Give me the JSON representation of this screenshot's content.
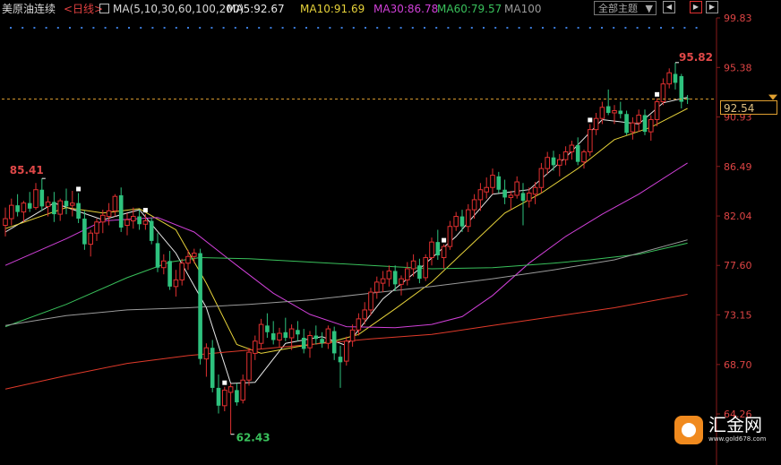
{
  "header": {
    "title": "美原油连续",
    "period": "<日线>",
    "ma_label": "MA(5,10,30,60,100,200)",
    "ma5": "MA5:92.67",
    "ma10": "MA10:91.69",
    "ma30": "MA30:86.78",
    "ma60": "MA60:79.57",
    "ma100": "MA100",
    "theme_dropdown": "全部主题",
    "theme_arrow": "▼"
  },
  "colors": {
    "up": "#e03030",
    "down": "#2ec27e",
    "ma5": "#e8e8e8",
    "ma10": "#e6d23a",
    "ma30": "#d040d8",
    "ma60": "#39c05b",
    "ma100": "#9a9a9a",
    "ma200": "#e03a2a",
    "current_line": "#e0a030"
  },
  "chart_data": {
    "type": "candlestick",
    "y_ticks": [
      "99.83",
      "95.38",
      "90.93",
      "86.49",
      "82.04",
      "77.60",
      "73.15",
      "68.70",
      "64.26"
    ],
    "ylim": [
      64.26,
      99.83
    ],
    "current_price": "92.54",
    "annotations": {
      "high_left": "85.41",
      "low": "62.43",
      "high_right": "95.82"
    },
    "candles": [
      [
        81.2,
        82.8,
        80.2,
        81.8
      ],
      [
        81.8,
        83.6,
        81.2,
        83.0
      ],
      [
        83.0,
        84.0,
        82.0,
        82.4
      ],
      [
        82.4,
        83.4,
        81.5,
        83.2
      ],
      [
        83.2,
        84.2,
        82.4,
        82.7
      ],
      [
        82.8,
        85.0,
        82.6,
        84.4
      ],
      [
        84.4,
        85.41,
        82.5,
        82.9
      ],
      [
        82.9,
        83.8,
        82.0,
        83.3
      ],
      [
        83.3,
        84.2,
        81.5,
        82.2
      ],
      [
        82.2,
        83.6,
        81.6,
        83.4
      ],
      [
        83.4,
        84.5,
        82.2,
        82.9
      ],
      [
        83.0,
        84.3,
        82.0,
        83.2
      ],
      [
        83.2,
        84.1,
        81.4,
        81.8
      ],
      [
        81.8,
        82.5,
        79.0,
        79.5
      ],
      [
        79.5,
        80.8,
        78.4,
        80.5
      ],
      [
        80.5,
        81.8,
        79.8,
        81.5
      ],
      [
        81.5,
        82.6,
        80.5,
        82.1
      ],
      [
        82.0,
        83.2,
        81.2,
        82.5
      ],
      [
        82.5,
        84.0,
        82.0,
        83.8
      ],
      [
        83.9,
        84.6,
        80.6,
        81.0
      ],
      [
        81.2,
        82.3,
        80.3,
        81.7
      ],
      [
        81.6,
        82.8,
        80.9,
        82.0
      ],
      [
        82.0,
        82.6,
        80.8,
        81.3
      ],
      [
        81.3,
        82.2,
        80.8,
        81.6
      ],
      [
        81.6,
        81.9,
        79.5,
        79.8
      ],
      [
        79.6,
        80.5,
        77.0,
        77.4
      ],
      [
        77.4,
        78.6,
        76.8,
        78.0
      ],
      [
        78.0,
        78.9,
        75.4,
        75.7
      ],
      [
        75.7,
        77.2,
        74.8,
        76.3
      ],
      [
        76.3,
        78.2,
        75.8,
        77.8
      ],
      [
        77.8,
        79.0,
        77.2,
        78.4
      ],
      [
        78.4,
        79.1,
        77.8,
        78.7
      ],
      [
        78.7,
        79.1,
        68.7,
        69.2
      ],
      [
        69.2,
        70.6,
        67.6,
        70.2
      ],
      [
        70.2,
        70.9,
        66.2,
        66.6
      ],
      [
        66.6,
        67.8,
        64.3,
        65.0
      ],
      [
        65.0,
        66.7,
        64.5,
        66.4
      ],
      [
        66.2,
        67.0,
        62.43,
        66.7
      ],
      [
        66.4,
        67.0,
        65.0,
        65.3
      ],
      [
        65.5,
        67.8,
        65.2,
        67.3
      ],
      [
        67.3,
        70.2,
        66.8,
        69.8
      ],
      [
        69.7,
        71.3,
        69.1,
        70.8
      ],
      [
        70.6,
        72.8,
        70.1,
        72.3
      ],
      [
        72.2,
        73.3,
        71.1,
        71.6
      ],
      [
        71.5,
        72.6,
        70.5,
        70.9
      ],
      [
        70.9,
        72.0,
        70.3,
        71.5
      ],
      [
        71.6,
        72.9,
        70.8,
        71.1
      ],
      [
        71.1,
        72.3,
        70.0,
        71.9
      ],
      [
        71.8,
        72.6,
        70.8,
        71.4
      ],
      [
        71.1,
        71.9,
        69.7,
        70.1
      ],
      [
        70.2,
        71.7,
        69.3,
        71.3
      ],
      [
        71.3,
        72.2,
        70.5,
        71.0
      ],
      [
        71.0,
        71.6,
        70.2,
        70.6
      ],
      [
        70.6,
        72.2,
        70.1,
        71.9
      ],
      [
        71.7,
        72.1,
        69.1,
        69.7
      ],
      [
        69.4,
        70.4,
        66.6,
        68.9
      ],
      [
        69.0,
        71.2,
        68.6,
        70.8
      ],
      [
        70.8,
        72.3,
        70.3,
        71.8
      ],
      [
        71.8,
        73.3,
        71.3,
        72.8
      ],
      [
        72.8,
        74.3,
        72.3,
        73.6
      ],
      [
        73.6,
        75.6,
        73.1,
        75.2
      ],
      [
        75.2,
        76.6,
        74.6,
        76.1
      ],
      [
        76.0,
        77.1,
        75.2,
        76.4
      ],
      [
        76.4,
        77.6,
        75.7,
        77.1
      ],
      [
        77.1,
        77.6,
        75.3,
        75.9
      ],
      [
        75.9,
        76.7,
        74.9,
        76.4
      ],
      [
        76.3,
        77.9,
        75.8,
        77.3
      ],
      [
        77.3,
        78.6,
        76.6,
        78.0
      ],
      [
        77.6,
        78.2,
        76.0,
        76.4
      ],
      [
        76.5,
        78.6,
        76.2,
        78.3
      ],
      [
        78.3,
        80.1,
        77.6,
        79.7
      ],
      [
        79.7,
        80.8,
        78.1,
        78.5
      ],
      [
        78.3,
        79.5,
        77.3,
        79.3
      ],
      [
        79.3,
        81.6,
        79.0,
        81.1
      ],
      [
        81.1,
        82.4,
        80.7,
        82.0
      ],
      [
        82.0,
        82.6,
        80.6,
        81.1
      ],
      [
        81.1,
        83.1,
        80.6,
        82.6
      ],
      [
        82.6,
        84.0,
        81.8,
        83.5
      ],
      [
        83.5,
        85.0,
        82.5,
        84.4
      ],
      [
        84.2,
        85.5,
        83.6,
        84.6
      ],
      [
        84.6,
        86.3,
        84.0,
        85.7
      ],
      [
        85.6,
        86.0,
        84.1,
        84.4
      ],
      [
        84.4,
        85.3,
        83.1,
        83.7
      ],
      [
        83.7,
        84.3,
        82.6,
        83.9
      ],
      [
        83.9,
        85.6,
        83.6,
        85.1
      ],
      [
        84.1,
        85.0,
        81.2,
        83.4
      ],
      [
        83.4,
        84.6,
        82.8,
        84.1
      ],
      [
        84.0,
        85.1,
        83.1,
        84.6
      ],
      [
        84.6,
        86.8,
        84.1,
        86.3
      ],
      [
        86.3,
        87.8,
        85.8,
        87.3
      ],
      [
        87.3,
        87.9,
        86.1,
        86.6
      ],
      [
        86.6,
        87.6,
        85.6,
        87.1
      ],
      [
        87.1,
        88.3,
        86.6,
        87.8
      ],
      [
        87.8,
        88.8,
        87.1,
        88.4
      ],
      [
        88.4,
        89.1,
        86.6,
        86.9
      ],
      [
        86.9,
        88.0,
        86.3,
        87.8
      ],
      [
        87.8,
        90.3,
        87.4,
        89.8
      ],
      [
        89.8,
        91.3,
        89.3,
        90.8
      ],
      [
        90.8,
        92.3,
        90.3,
        91.8
      ],
      [
        91.9,
        93.4,
        91.1,
        91.3
      ],
      [
        91.3,
        92.0,
        90.3,
        91.5
      ],
      [
        91.5,
        92.3,
        90.8,
        91.2
      ],
      [
        91.2,
        91.5,
        89.3,
        89.5
      ],
      [
        89.6,
        90.9,
        88.9,
        90.4
      ],
      [
        90.4,
        91.6,
        89.6,
        91.1
      ],
      [
        91.1,
        91.6,
        89.3,
        89.6
      ],
      [
        89.6,
        91.1,
        88.8,
        90.7
      ],
      [
        90.7,
        92.6,
        90.1,
        92.3
      ],
      [
        92.3,
        94.4,
        92.0,
        93.9
      ],
      [
        93.9,
        95.3,
        93.5,
        94.9
      ],
      [
        94.8,
        95.82,
        93.4,
        94.0
      ],
      [
        94.6,
        94.8,
        91.7,
        92.3
      ],
      [
        92.6,
        92.9,
        92.1,
        92.54
      ]
    ],
    "ma_lines": [
      {
        "name": "MA5",
        "color_key": "ma5",
        "points": [
          [
            0,
            80.6
          ],
          [
            8,
            83.2
          ],
          [
            16,
            81.7
          ],
          [
            22,
            82.6
          ],
          [
            28,
            78.7
          ],
          [
            33,
            73.8
          ],
          [
            37,
            67.0
          ],
          [
            41,
            67.1
          ],
          [
            46,
            70.6
          ],
          [
            52,
            71.2
          ],
          [
            56,
            70.4
          ],
          [
            62,
            74.6
          ],
          [
            68,
            77.3
          ],
          [
            74,
            80.2
          ],
          [
            80,
            84.0
          ],
          [
            86,
            84.4
          ],
          [
            92,
            87.3
          ],
          [
            98,
            90.7
          ],
          [
            104,
            90.3
          ],
          [
            108,
            92.2
          ],
          [
            112,
            92.7
          ]
        ]
      },
      {
        "name": "MA10",
        "color_key": "ma10",
        "points": [
          [
            0,
            80.9
          ],
          [
            10,
            82.8
          ],
          [
            16,
            82.3
          ],
          [
            22,
            82.7
          ],
          [
            28,
            80.8
          ],
          [
            33,
            76.0
          ],
          [
            38,
            70.5
          ],
          [
            42,
            69.7
          ],
          [
            48,
            70.3
          ],
          [
            54,
            70.8
          ],
          [
            58,
            71.4
          ],
          [
            64,
            73.7
          ],
          [
            70,
            76.1
          ],
          [
            76,
            79.2
          ],
          [
            82,
            82.3
          ],
          [
            88,
            84.1
          ],
          [
            94,
            86.3
          ],
          [
            100,
            88.9
          ],
          [
            106,
            90.0
          ],
          [
            112,
            91.7
          ]
        ]
      },
      {
        "name": "MA30",
        "color_key": "ma30",
        "points": [
          [
            0,
            77.6
          ],
          [
            10,
            80.0
          ],
          [
            16,
            81.6
          ],
          [
            25,
            81.9
          ],
          [
            31,
            80.6
          ],
          [
            38,
            77.6
          ],
          [
            44,
            75.1
          ],
          [
            50,
            73.2
          ],
          [
            56,
            72.1
          ],
          [
            64,
            72.0
          ],
          [
            70,
            72.3
          ],
          [
            75,
            73.0
          ],
          [
            80,
            74.9
          ],
          [
            86,
            77.8
          ],
          [
            92,
            80.2
          ],
          [
            98,
            82.2
          ],
          [
            104,
            84.0
          ],
          [
            112,
            86.8
          ]
        ]
      },
      {
        "name": "MA60",
        "color_key": "ma60",
        "points": [
          [
            0,
            72.1
          ],
          [
            10,
            74.1
          ],
          [
            20,
            76.5
          ],
          [
            27,
            77.9
          ],
          [
            32,
            78.3
          ],
          [
            40,
            78.2
          ],
          [
            50,
            77.9
          ],
          [
            60,
            77.6
          ],
          [
            70,
            77.3
          ],
          [
            80,
            77.4
          ],
          [
            90,
            77.8
          ],
          [
            96,
            78.1
          ],
          [
            104,
            78.6
          ],
          [
            112,
            79.6
          ]
        ]
      },
      {
        "name": "MA100",
        "color_key": "ma100",
        "points": [
          [
            0,
            72.2
          ],
          [
            10,
            73.1
          ],
          [
            20,
            73.6
          ],
          [
            30,
            73.8
          ],
          [
            40,
            74.1
          ],
          [
            50,
            74.5
          ],
          [
            60,
            75.1
          ],
          [
            70,
            75.7
          ],
          [
            80,
            76.4
          ],
          [
            90,
            77.2
          ],
          [
            100,
            78.1
          ],
          [
            112,
            79.9
          ]
        ]
      },
      {
        "name": "MA200",
        "color_key": "ma200",
        "points": [
          [
            0,
            66.5
          ],
          [
            10,
            67.7
          ],
          [
            20,
            68.8
          ],
          [
            30,
            69.5
          ],
          [
            40,
            70.0
          ],
          [
            50,
            70.5
          ],
          [
            60,
            71.0
          ],
          [
            70,
            71.4
          ],
          [
            80,
            72.2
          ],
          [
            90,
            73.0
          ],
          [
            100,
            73.8
          ],
          [
            112,
            75.0
          ]
        ]
      }
    ]
  },
  "logo": {
    "name": "汇金网",
    "url": "www.gold678.com"
  }
}
